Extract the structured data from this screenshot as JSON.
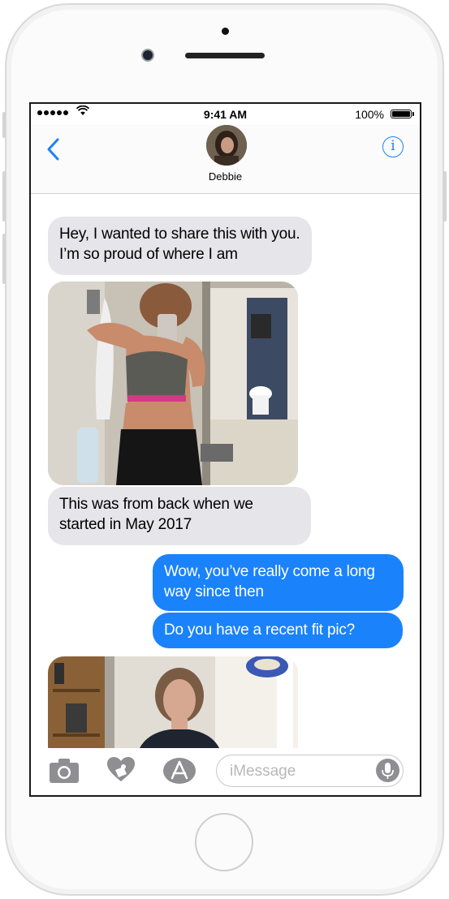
{
  "status_bar": {
    "time": "9:41 AM",
    "battery_percent": "100%"
  },
  "header": {
    "contact_name": "Debbie"
  },
  "messages": [
    {
      "direction": "incoming",
      "type": "text",
      "text": "Hey, I wanted to share this with you. I’m so proud of where I am"
    },
    {
      "direction": "incoming",
      "type": "photo"
    },
    {
      "direction": "incoming",
      "type": "text",
      "text": "This was from back when we started in May 2017"
    },
    {
      "direction": "outgoing",
      "type": "text",
      "text": "Wow, you’ve really come a long way since then"
    },
    {
      "direction": "outgoing",
      "type": "text",
      "text": "Do you have a recent fit pic?"
    },
    {
      "direction": "incoming",
      "type": "photo"
    }
  ],
  "compose": {
    "placeholder": "iMessage"
  },
  "colors": {
    "accent": "#1a82fb",
    "incoming_bubble": "#e5e5ea",
    "outgoing_bubble": "#1a82fb"
  },
  "icons": [
    "back-chevron-icon",
    "info-icon",
    "camera-icon",
    "digital-touch-icon",
    "app-store-icon",
    "microphone-icon"
  ]
}
